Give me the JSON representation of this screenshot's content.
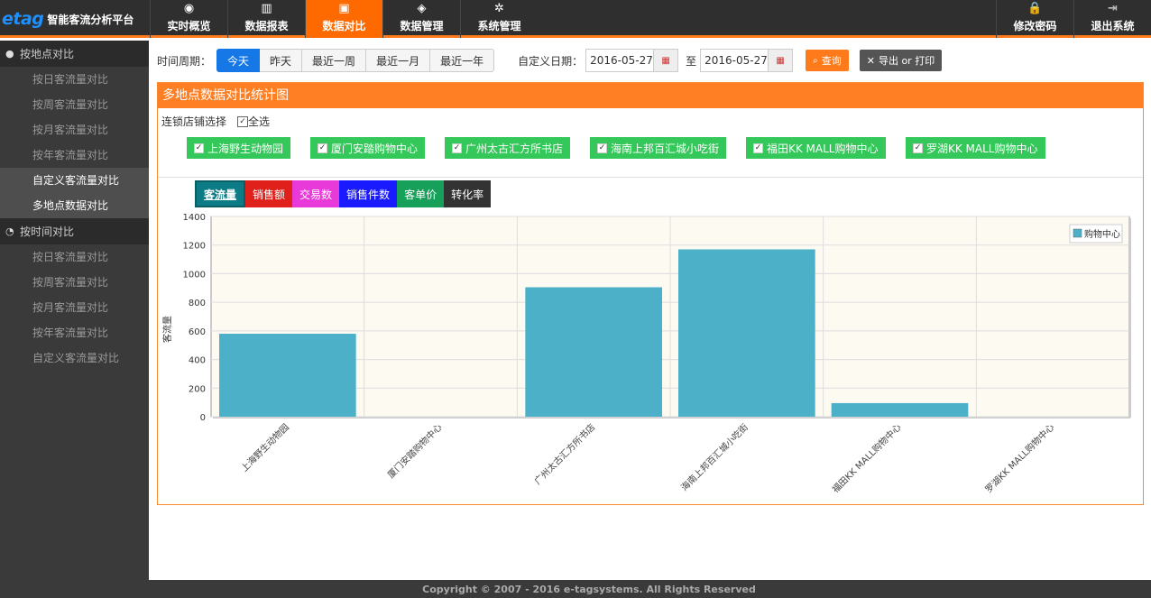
{
  "brand": {
    "logo": "etag",
    "title": "智能客流分析平台"
  },
  "nav_left": [
    {
      "label": "实时概览",
      "icon": "eye-icon",
      "glyph": "◉"
    },
    {
      "label": "数据报表",
      "icon": "bar-chart-icon",
      "glyph": "▥"
    },
    {
      "label": "数据对比",
      "icon": "image-icon",
      "glyph": "▣",
      "active": true
    },
    {
      "label": "数据管理",
      "icon": "activity-icon",
      "glyph": "◈"
    },
    {
      "label": "系统管理",
      "icon": "gear-icon",
      "glyph": "✲"
    }
  ],
  "nav_right": [
    {
      "label": "修改密码",
      "icon": "lock-icon",
      "glyph": "🔒"
    },
    {
      "label": "退出系统",
      "icon": "logout-icon",
      "glyph": "⇥"
    }
  ],
  "sidebar": {
    "group1": {
      "title": "按地点对比",
      "items": [
        "按日客流量对比",
        "按周客流量对比",
        "按月客流量对比",
        "按年客流量对比",
        "自定义客流量对比",
        "多地点数据对比"
      ]
    },
    "group2": {
      "title": "按时间对比",
      "items": [
        "按日客流量对比",
        "按周客流量对比",
        "按月客流量对比",
        "按年客流量对比",
        "自定义客流量对比"
      ]
    }
  },
  "toolbar": {
    "period_label": "时间周期：",
    "periods": [
      "今天",
      "昨天",
      "最近一周",
      "最近一月",
      "最近一年"
    ],
    "custom_label": "自定义日期：",
    "date_from": "2016-05-27",
    "to_label": "至",
    "date_to": "2016-05-27",
    "query_label": "查询",
    "export_label": "导出 or 打印"
  },
  "panel": {
    "title": "多地点数据对比统计图",
    "store_select_label": "连锁店铺选择",
    "select_all_label": "全选",
    "stores": [
      "上海野生动物园",
      "厦门安踏购物中心",
      "广州太古汇方所书店",
      "海南上邦百汇城小吃街",
      "福田KK MALL购物中心",
      "罗湖KK MALL购物中心"
    ]
  },
  "metric_tabs": [
    {
      "label": "客流量",
      "color": "#0e7c86",
      "active": true
    },
    {
      "label": "销售额",
      "color": "#e0201a"
    },
    {
      "label": "交易数",
      "color": "#e83ad8"
    },
    {
      "label": "销售件数",
      "color": "#1a1aff"
    },
    {
      "label": "客单价",
      "color": "#16a05a"
    },
    {
      "label": "转化率",
      "color": "#333333"
    }
  ],
  "chart_data": {
    "type": "bar",
    "categories": [
      "上海野生动物园",
      "厦门安踏购物中心",
      "广州太古汇方所书店",
      "海南上邦百汇城小吃街",
      "福田KK MALL购物中心",
      "罗湖KK MALL购物中心"
    ],
    "series": [
      {
        "name": "购物中心",
        "values": [
          580,
          0,
          905,
          1170,
          95,
          0
        ]
      }
    ],
    "ylabel": "客流量",
    "ylim": [
      0,
      1400
    ],
    "yticks": [
      0,
      200,
      400,
      600,
      800,
      1000,
      1200,
      1400
    ],
    "bar_color": "#4bb0c8",
    "legend_position": "top-right",
    "grid": true
  },
  "footer": "Copyright © 2007 - 2016 e-tagsystems. All Rights Reserved"
}
